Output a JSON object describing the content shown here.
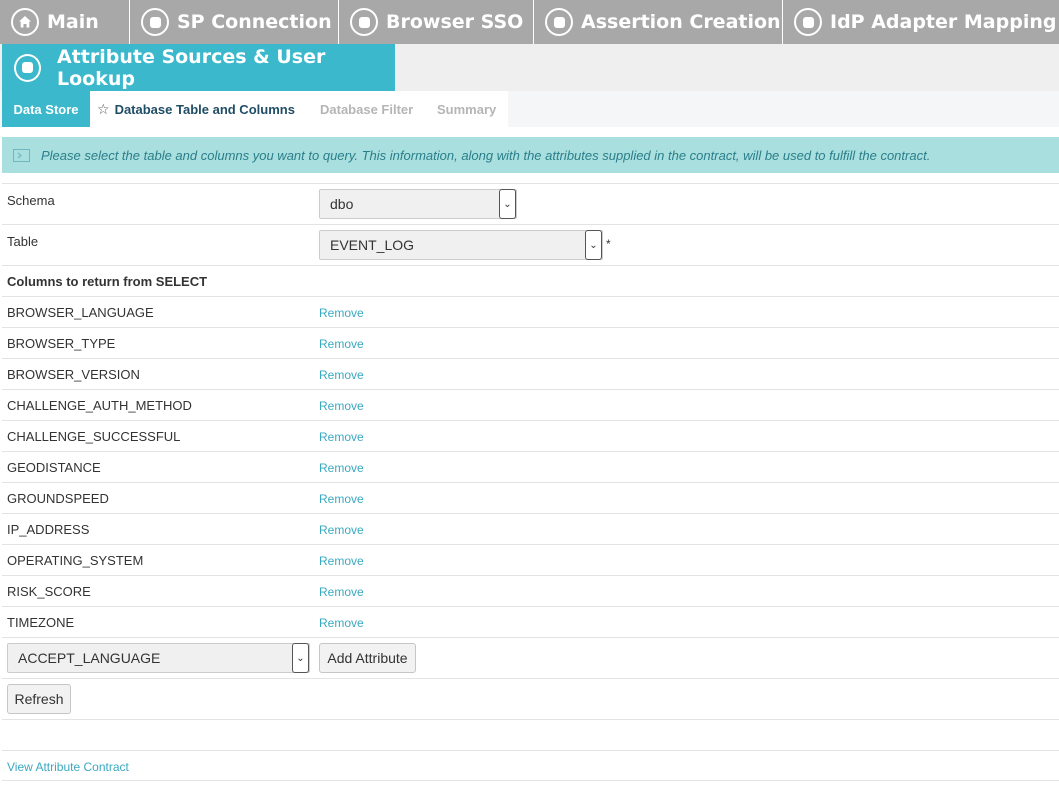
{
  "top_nav": [
    {
      "label": "Main",
      "icon": "home-icon"
    },
    {
      "label": "SP Connection",
      "icon": "step-icon"
    },
    {
      "label": "Browser SSO",
      "icon": "step-icon"
    },
    {
      "label": "Assertion Creation",
      "icon": "step-icon"
    },
    {
      "label": "IdP Adapter Mapping",
      "icon": "step-icon"
    }
  ],
  "active_step": {
    "label": "Attribute Sources & User Lookup"
  },
  "sub_tabs": [
    {
      "label": "Data Store",
      "state": "completed"
    },
    {
      "label": "Database Table and Columns",
      "state": "current"
    },
    {
      "label": "Database Filter",
      "state": "disabled"
    },
    {
      "label": "Summary",
      "state": "disabled"
    }
  ],
  "info": {
    "message": "Please select the table and columns you want to query. This information, along with the attributes supplied in the contract, will be used to fulfill the contract."
  },
  "form": {
    "schema_label": "Schema",
    "schema_value": "dbo",
    "table_label": "Table",
    "table_value": "EVENT_LOG",
    "required_mark": "*",
    "columns_heading": "Columns to return from SELECT",
    "remove_label": "Remove",
    "columns": [
      "BROWSER_LANGUAGE",
      "BROWSER_TYPE",
      "BROWSER_VERSION",
      "CHALLENGE_AUTH_METHOD",
      "CHALLENGE_SUCCESSFUL",
      "GEODISTANCE",
      "GROUNDSPEED",
      "IP_ADDRESS",
      "OPERATING_SYSTEM",
      "RISK_SCORE",
      "TIMEZONE"
    ],
    "attribute_select_value": "ACCEPT_LANGUAGE",
    "add_attribute_label": "Add Attribute",
    "refresh_label": "Refresh"
  },
  "footer": {
    "view_contract_label": "View Attribute Contract"
  },
  "colors": {
    "accent": "#3bb8cc",
    "tab_gray": "#a8a8a8",
    "info_bg": "#a9dfdf",
    "link": "#3aa9c0"
  }
}
